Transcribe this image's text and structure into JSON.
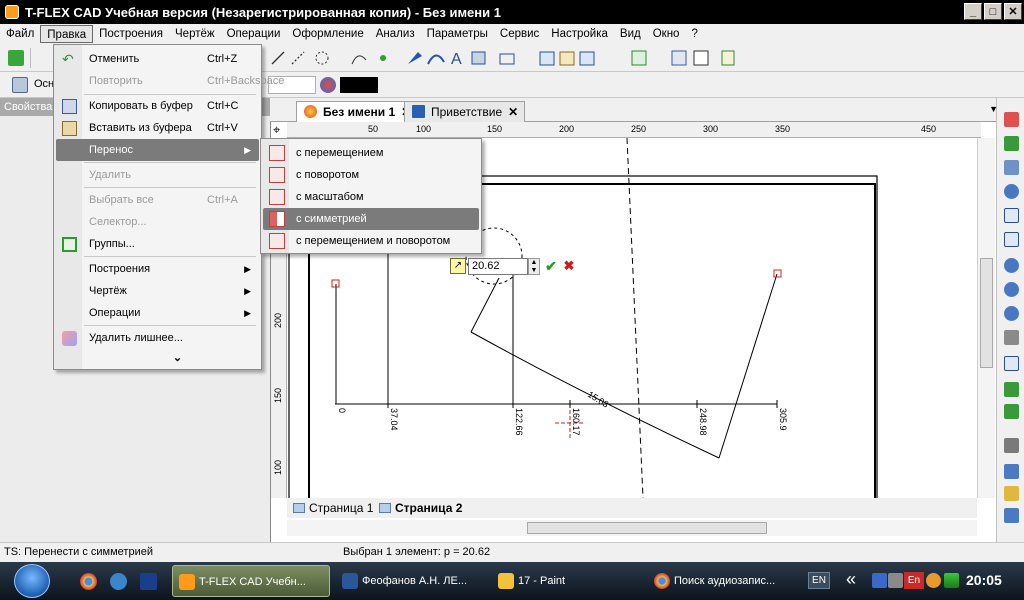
{
  "window": {
    "title": "T-FLEX CAD Учебная версия (Незарегистрированная копия) - Без имени 1",
    "minimize": "_",
    "maximize": "□",
    "close": "✕"
  },
  "menubar": [
    "Файл",
    "Правка",
    "Построения",
    "Чертёж",
    "Операции",
    "Оформление",
    "Анализ",
    "Параметры",
    "Сервис",
    "Настройка",
    "Вид",
    "Окно",
    "?"
  ],
  "toolbar2": {
    "label": "Осн"
  },
  "left_panel": {
    "header": "Свойства"
  },
  "doc_tabs": [
    {
      "label": "Без имени 1",
      "close": "✕"
    },
    {
      "label": "Приветствие",
      "close": "✕"
    }
  ],
  "ruler": {
    "top": [
      "50",
      "100",
      "150",
      "200",
      "250",
      "300",
      "350",
      "450"
    ],
    "left": [
      "200",
      "150",
      "100"
    ]
  },
  "edit_menu": {
    "undo": {
      "label": "Отменить",
      "shortcut": "Ctrl+Z"
    },
    "redo": {
      "label": "Повторить",
      "shortcut": "Ctrl+Backspace"
    },
    "copy": {
      "label": "Копировать в буфер",
      "shortcut": "Ctrl+C"
    },
    "paste": {
      "label": "Вставить из буфера",
      "shortcut": "Ctrl+V"
    },
    "transfer": {
      "label": "Перенос"
    },
    "delete": {
      "label": "Удалить"
    },
    "select_all": {
      "label": "Выбрать все",
      "shortcut": "Ctrl+A"
    },
    "selector": {
      "label": "Селектор..."
    },
    "groups": {
      "label": "Группы..."
    },
    "constructions": {
      "label": "Построения"
    },
    "drawing": {
      "label": "Чертёж"
    },
    "operations": {
      "label": "Операции"
    },
    "remove_extra": {
      "label": "Удалить лишнее..."
    },
    "expand": "⌄"
  },
  "transfer_submenu": [
    {
      "label": "с перемещением"
    },
    {
      "label": "с поворотом"
    },
    {
      "label": "с масштабом"
    },
    {
      "label": "с симметрией"
    },
    {
      "label": "с перемещением и поворотом"
    }
  ],
  "parameter_input": {
    "value": "20.62",
    "ok": "✔",
    "cancel": "✖"
  },
  "drawing_labels": [
    "0",
    "37.04",
    "122.66",
    "160.17",
    "248.98",
    "305.9",
    "15.03"
  ],
  "page_tabs": [
    {
      "label": "Страница 1"
    },
    {
      "label": "Страница 2"
    }
  ],
  "status": {
    "left": "TS: Перенести с симметрией",
    "middle": "Выбран 1 элемент: p = 20.62"
  },
  "taskbar": {
    "tasks": [
      {
        "label": "T-FLEX CAD Учебн..."
      },
      {
        "label": "Феофанов А.Н. ЛЕ..."
      },
      {
        "label": "17 - Paint"
      },
      {
        "label": "Поиск аудиозапис..."
      }
    ],
    "lang": "EN",
    "tray_lang": "En",
    "chevrons": "«",
    "clock": "20:05"
  }
}
